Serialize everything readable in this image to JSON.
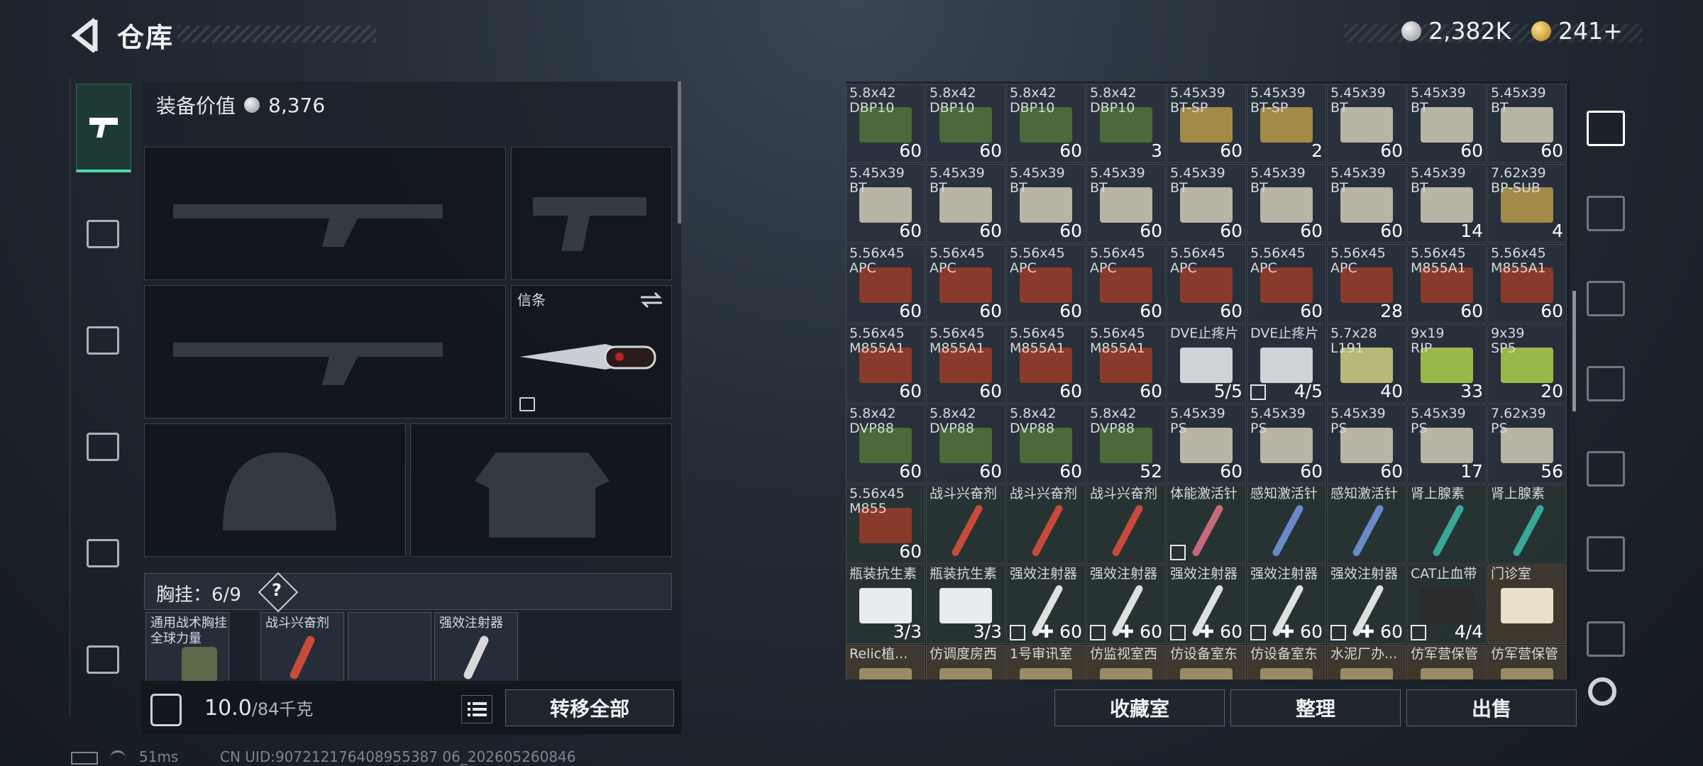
{
  "header": {
    "title": "仓库",
    "silver": "2,382K",
    "gold": "241+"
  },
  "loadout": {
    "value_label": "装备价值",
    "value": "8,376",
    "melee_label": "信条",
    "vest_label": "胸挂：",
    "vest_count": "6/9",
    "vest_help": "?",
    "vest_slots": [
      {
        "label": "通用战术胸挂\n全球力量"
      },
      {
        "label": "战斗兴奋剂"
      },
      {
        "label": ""
      },
      {
        "label": "强效注射器"
      }
    ],
    "weight": "10.0",
    "weight_max": "/84千克",
    "transfer_all": "转移全部"
  },
  "stash": {
    "items": [
      {
        "name": "5.8x42\nDBP10",
        "count": "60",
        "type": "ammo-green"
      },
      {
        "name": "5.8x42\nDBP10",
        "count": "60",
        "type": "ammo-green"
      },
      {
        "name": "5.8x42\nDBP10",
        "count": "60",
        "type": "ammo-green"
      },
      {
        "name": "5.8x42\nDBP10",
        "count": "3",
        "type": "ammo-green"
      },
      {
        "name": "5.45x39\nBT-SP",
        "count": "60",
        "type": "bullet"
      },
      {
        "name": "5.45x39\nBT-SP",
        "count": "2",
        "type": "bullet"
      },
      {
        "name": "5.45x39\nBT",
        "count": "60",
        "type": "ammo-white"
      },
      {
        "name": "5.45x39\nBT",
        "count": "60",
        "type": "ammo-white"
      },
      {
        "name": "5.45x39\nBT",
        "count": "60",
        "type": "ammo-white"
      },
      {
        "name": "5.45x39\nBT",
        "count": "60",
        "type": "ammo-white"
      },
      {
        "name": "5.45x39\nBT",
        "count": "60",
        "type": "ammo-white"
      },
      {
        "name": "5.45x39\nBT",
        "count": "60",
        "type": "ammo-white"
      },
      {
        "name": "5.45x39\nBT",
        "count": "60",
        "type": "ammo-white"
      },
      {
        "name": "5.45x39\nBT",
        "count": "60",
        "type": "ammo-white"
      },
      {
        "name": "5.45x39\nBT",
        "count": "60",
        "type": "ammo-white"
      },
      {
        "name": "5.45x39\nBT",
        "count": "60",
        "type": "ammo-white"
      },
      {
        "name": "5.45x39\nBT",
        "count": "14",
        "type": "ammo-white"
      },
      {
        "name": "7.62x39\nBP-SUB",
        "count": "4",
        "type": "bullet"
      },
      {
        "name": "5.56x45\nAPC",
        "count": "60",
        "type": "ammo-red"
      },
      {
        "name": "5.56x45\nAPC",
        "count": "60",
        "type": "ammo-red"
      },
      {
        "name": "5.56x45\nAPC",
        "count": "60",
        "type": "ammo-red"
      },
      {
        "name": "5.56x45\nAPC",
        "count": "60",
        "type": "ammo-red"
      },
      {
        "name": "5.56x45\nAPC",
        "count": "60",
        "type": "ammo-red"
      },
      {
        "name": "5.56x45\nAPC",
        "count": "60",
        "type": "ammo-red"
      },
      {
        "name": "5.56x45\nAPC",
        "count": "28",
        "type": "ammo-red"
      },
      {
        "name": "5.56x45\nM855A1",
        "count": "60",
        "type": "ammo-red"
      },
      {
        "name": "5.56x45\nM855A1",
        "count": "60",
        "type": "ammo-red"
      },
      {
        "name": "5.56x45\nM855A1",
        "count": "60",
        "type": "ammo-red"
      },
      {
        "name": "5.56x45\nM855A1",
        "count": "60",
        "type": "ammo-red"
      },
      {
        "name": "5.56x45\nM855A1",
        "count": "60",
        "type": "ammo-red"
      },
      {
        "name": "5.56x45\nM855A1",
        "count": "60",
        "type": "ammo-red"
      },
      {
        "name": "DVE止疼片",
        "count": "5/5",
        "type": "pill"
      },
      {
        "name": "DVE止疼片",
        "count": "4/5",
        "type": "pill",
        "badge": true
      },
      {
        "name": "5.7x28\nL191",
        "count": "40",
        "type": "ammo-yellow"
      },
      {
        "name": "9x19\nRIP",
        "count": "33",
        "type": "ammo-lime"
      },
      {
        "name": "9x39\nSP5",
        "count": "20",
        "type": "ammo-lime"
      },
      {
        "name": "5.8x42\nDVP88",
        "count": "60",
        "type": "ammo-green"
      },
      {
        "name": "5.8x42\nDVP88",
        "count": "60",
        "type": "ammo-green"
      },
      {
        "name": "5.8x42\nDVP88",
        "count": "60",
        "type": "ammo-green"
      },
      {
        "name": "5.8x42\nDVP88",
        "count": "52",
        "type": "ammo-green"
      },
      {
        "name": "5.45x39\nPS",
        "count": "60",
        "type": "ammo-white"
      },
      {
        "name": "5.45x39\nPS",
        "count": "60",
        "type": "ammo-white"
      },
      {
        "name": "5.45x39\nPS",
        "count": "60",
        "type": "ammo-white"
      },
      {
        "name": "5.45x39\nPS",
        "count": "17",
        "type": "ammo-white"
      },
      {
        "name": "7.62x39\nPS",
        "count": "56",
        "type": "ammo-white"
      },
      {
        "name": "5.56x45\nM855",
        "count": "60",
        "type": "ammo-red"
      },
      {
        "name": "战斗兴奋剂",
        "count": "",
        "type": "syr-red"
      },
      {
        "name": "战斗兴奋剂",
        "count": "",
        "type": "syr-red"
      },
      {
        "name": "战斗兴奋剂",
        "count": "",
        "type": "syr-red"
      },
      {
        "name": "体能激活针",
        "count": "",
        "type": "syr-pink",
        "badge": true
      },
      {
        "name": "感知激活针",
        "count": "",
        "type": "syr-blue"
      },
      {
        "name": "感知激活针",
        "count": "",
        "type": "syr-blue"
      },
      {
        "name": "肾上腺素",
        "count": "",
        "type": "syr-teal"
      },
      {
        "name": "肾上腺素",
        "count": "",
        "type": "syr-teal"
      },
      {
        "name": "瓶装抗生素",
        "count": "3/3",
        "type": "bottle"
      },
      {
        "name": "瓶装抗生素",
        "count": "3/3",
        "type": "bottle"
      },
      {
        "name": "强效注射器",
        "count": "✚ 60",
        "type": "syr-white",
        "badge": true
      },
      {
        "name": "强效注射器",
        "count": "✚ 60",
        "type": "syr-white",
        "badge": true
      },
      {
        "name": "强效注射器",
        "count": "✚ 60",
        "type": "syr-white",
        "badge": true
      },
      {
        "name": "强效注射器",
        "count": "✚ 60",
        "type": "syr-white",
        "badge": true
      },
      {
        "name": "强效注射器",
        "count": "✚ 60",
        "type": "syr-white",
        "badge": true
      },
      {
        "name": "CAT止血带",
        "count": "4/4",
        "type": "tourniquet",
        "badge": true
      },
      {
        "name": "门诊室",
        "count": "",
        "type": "card"
      },
      {
        "name": "Relic植...",
        "count": "",
        "type": "key"
      },
      {
        "name": "仿调度房西",
        "count": "",
        "type": "key"
      },
      {
        "name": "1号审讯室",
        "count": "",
        "type": "key"
      },
      {
        "name": "仿监视室西",
        "count": "",
        "type": "key"
      },
      {
        "name": "仿设备室东",
        "count": "",
        "type": "key"
      },
      {
        "name": "仿设备室东",
        "count": "",
        "type": "key"
      },
      {
        "name": "水泥厂办...",
        "count": "",
        "type": "key"
      },
      {
        "name": "仿军营保管",
        "count": "",
        "type": "key"
      },
      {
        "name": "仿军营保管",
        "count": "",
        "type": "key"
      }
    ],
    "btn_collection": "收藏室",
    "btn_sort": "整理",
    "btn_sell": "出售"
  },
  "footer": {
    "ping": "51ms",
    "uid": "CN UID:907212176408955387 06_202605260846"
  }
}
